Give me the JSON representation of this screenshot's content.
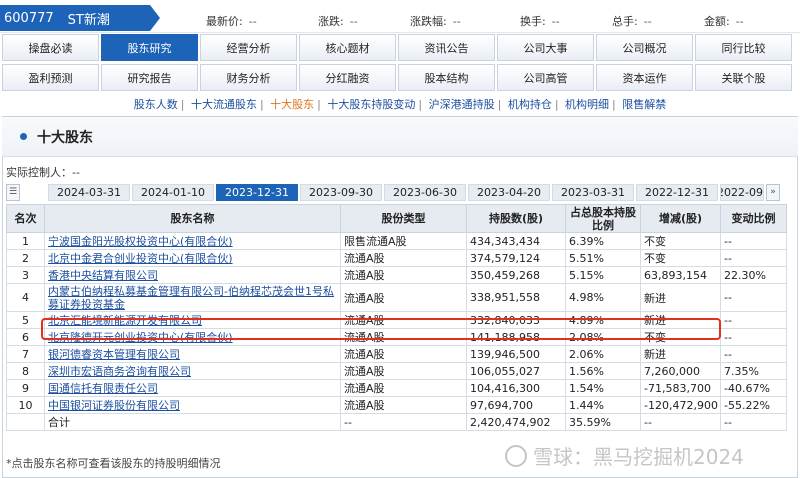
{
  "quote": {
    "code": "600777",
    "name": "ST新潮",
    "items": [
      {
        "label": "最新价:",
        "value": "--"
      },
      {
        "label": "涨跌:",
        "value": "--"
      },
      {
        "label": "涨跌幅:",
        "value": "--"
      },
      {
        "label": "换手:",
        "value": "--"
      },
      {
        "label": "总手:",
        "value": "--"
      },
      {
        "label": "金额:",
        "value": "--"
      }
    ]
  },
  "nav": {
    "row1": [
      "操盘必读",
      "股东研究",
      "经营分析",
      "核心题材",
      "资讯公告",
      "公司大事",
      "公司概况",
      "同行比较"
    ],
    "row2": [
      "盈利预测",
      "研究报告",
      "财务分析",
      "分红融资",
      "股本结构",
      "公司高管",
      "资本运作",
      "关联个股"
    ],
    "active": "股东研究"
  },
  "subnav": [
    "股东人数",
    "十大流通股东",
    "十大股东",
    "十大股东持股变动",
    "沪深港通持股",
    "机构持仓",
    "机构明细",
    "限售解禁"
  ],
  "subnav_active": "十大股东",
  "section_title": "十大股东",
  "controller": "实际控制人：--",
  "dates": [
    "2024-03-31",
    "2024-01-10",
    "2023-12-31",
    "2023-09-30",
    "2023-06-30",
    "2023-04-20",
    "2023-03-31",
    "2022-12-31",
    "2022-09-"
  ],
  "active_date": "2023-12-31",
  "table": {
    "headers": [
      "名次",
      "股东名称",
      "股份类型",
      "持股数(股)",
      "占总股本持股比例",
      "增减(股)",
      "变动比例"
    ],
    "rows": [
      {
        "rank": "1",
        "name": "宁波国金阳光股权投资中心(有限合伙)",
        "type": "限售流通A股",
        "shares": "434,343,434",
        "ratio": "6.39%",
        "change": "不变",
        "change_pct": "--"
      },
      {
        "rank": "2",
        "name": "北京中金君合创业投资中心(有限合伙)",
        "type": "流通A股",
        "shares": "374,579,124",
        "ratio": "5.51%",
        "change": "不变",
        "change_pct": "--"
      },
      {
        "rank": "3",
        "name": "香港中央结算有限公司",
        "type": "流通A股",
        "shares": "350,459,268",
        "ratio": "5.15%",
        "change": "63,893,154",
        "change_pct": "22.30%"
      },
      {
        "rank": "4",
        "name": "内蒙古伯纳程私募基金管理有限公司-伯纳程芯茂会世1号私募证券投资基金",
        "type": "流通A股",
        "shares": "338,951,558",
        "ratio": "4.98%",
        "change": "新进",
        "change_pct": "--"
      },
      {
        "rank": "5",
        "name": "北京汇能境新能源开发有限公司",
        "type": "流通A股",
        "shares": "332,840,033",
        "ratio": "4.89%",
        "change": "新进",
        "change_pct": "--"
      },
      {
        "rank": "6",
        "name": "北京隆德开元创业投资中心(有限合伙)",
        "type": "流通A股",
        "shares": "141,188,958",
        "ratio": "2.08%",
        "change": "不变",
        "change_pct": "--"
      },
      {
        "rank": "7",
        "name": "银河德睿资本管理有限公司",
        "type": "流通A股",
        "shares": "139,946,500",
        "ratio": "2.06%",
        "change": "新进",
        "change_pct": "--"
      },
      {
        "rank": "8",
        "name": "深圳市宏语商务咨询有限公司",
        "type": "流通A股",
        "shares": "106,055,027",
        "ratio": "1.56%",
        "change": "7,260,000",
        "change_pct": "7.35%"
      },
      {
        "rank": "9",
        "name": "国通信托有限责任公司",
        "type": "流通A股",
        "shares": "104,416,300",
        "ratio": "1.54%",
        "change": "-71,583,700",
        "change_pct": "-40.67%"
      },
      {
        "rank": "10",
        "name": "中国银河证券股份有限公司",
        "type": "流通A股",
        "shares": "97,694,700",
        "ratio": "1.44%",
        "change": "-120,472,900",
        "change_pct": "-55.22%"
      }
    ],
    "total": {
      "label": "合计",
      "type": "--",
      "shares": "2,420,474,902",
      "ratio": "35.59%",
      "change": "--",
      "change_pct": "--"
    }
  },
  "footnote": "*点击股东名称可查看该股东的持股明细情况",
  "watermark": "雪球：黑马挖掘机2024",
  "colors": {
    "accent": "#1d63b8",
    "active_subnav": "#e0741b",
    "positive": "#e0231c",
    "negative": "#12a24a",
    "highlight": "#e0301e"
  }
}
